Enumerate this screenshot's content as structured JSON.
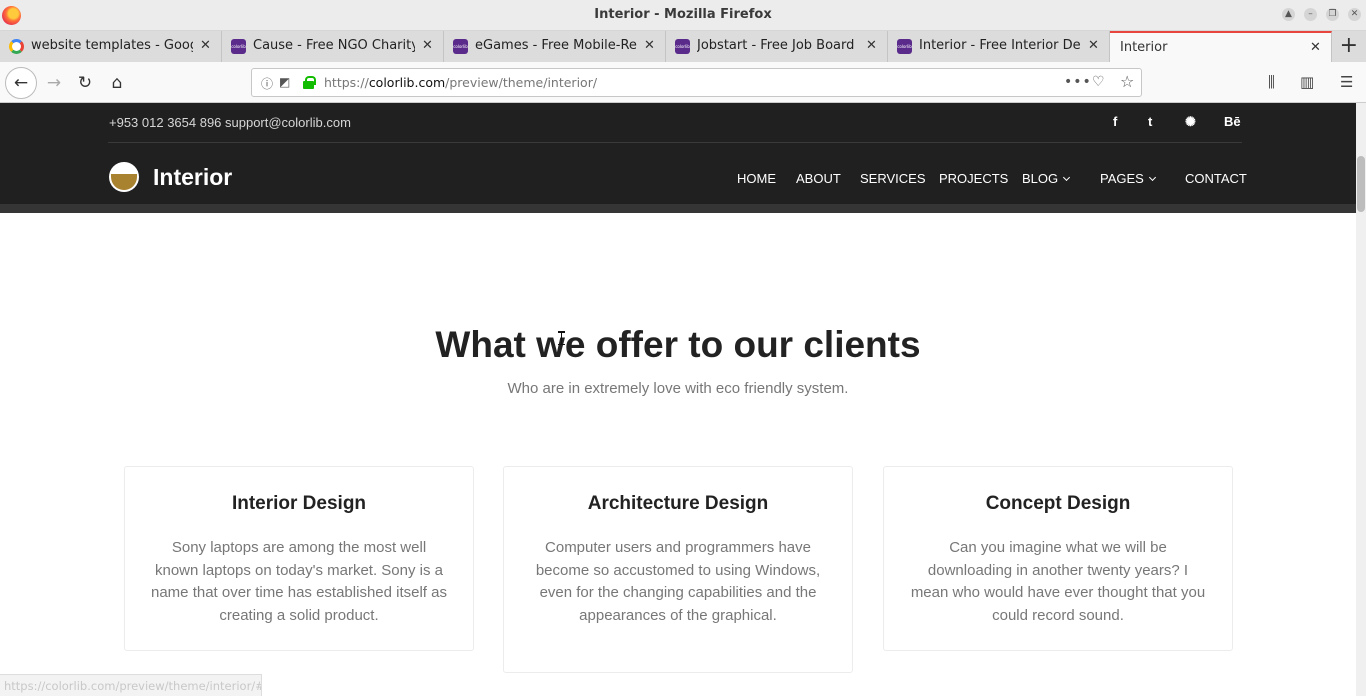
{
  "window": {
    "title": "Interior - Mozilla Firefox"
  },
  "tabs": [
    {
      "label": "website templates - Google S",
      "favicon": "google-icon"
    },
    {
      "label": "Cause - Free NGO Charity We",
      "favicon": "colorlib-icon"
    },
    {
      "label": "eGames - Free Mobile-Ready",
      "favicon": "colorlib-icon"
    },
    {
      "label": "Jobstart - Free Job Board Web",
      "favicon": "colorlib-icon"
    },
    {
      "label": "Interior - Free Interior Design",
      "favicon": "colorlib-icon"
    },
    {
      "label": "Interior",
      "favicon": ""
    }
  ],
  "urlbar": {
    "url_prefix": "https://",
    "url_domain": "colorlib.com",
    "url_path": "/preview/theme/interior/"
  },
  "site": {
    "topbar": {
      "phone": "+953 012 3654 896",
      "email": "support@colorlib.com",
      "social": [
        {
          "label": "f",
          "icon": "facebook-icon"
        },
        {
          "label": "t",
          "icon": "twitter-icon"
        },
        {
          "label": "✺",
          "icon": "dribbble-icon"
        },
        {
          "label": "Bē",
          "icon": "behance-icon"
        }
      ]
    },
    "logo": "Interior",
    "menu": {
      "home": "HOME",
      "about": "ABOUT",
      "services": "SERVICES",
      "projects": "PROJECTS",
      "blog": "BLOG",
      "pages": "PAGES",
      "contact": "CONTACT"
    },
    "offers": {
      "title": "What we offer to our clients",
      "subtitle": "Who are in extremely love with eco friendly system.",
      "cards": [
        {
          "title": "Interior Design",
          "text": "Sony laptops are among the most well known laptops on today's market. Sony is a name that over time has established itself as creating a solid product."
        },
        {
          "title": "Architecture Design",
          "text": "Computer users and programmers have become so accustomed to using Windows, even for the changing capabilities and the appearances of the graphical."
        },
        {
          "title": "Concept Design",
          "text": "Can you imagine what we will be downloading in another twenty years? I mean who would have ever thought that you could record sound."
        }
      ]
    }
  },
  "statusbar": {
    "text": "https://colorlib.com/preview/theme/interior/#"
  }
}
